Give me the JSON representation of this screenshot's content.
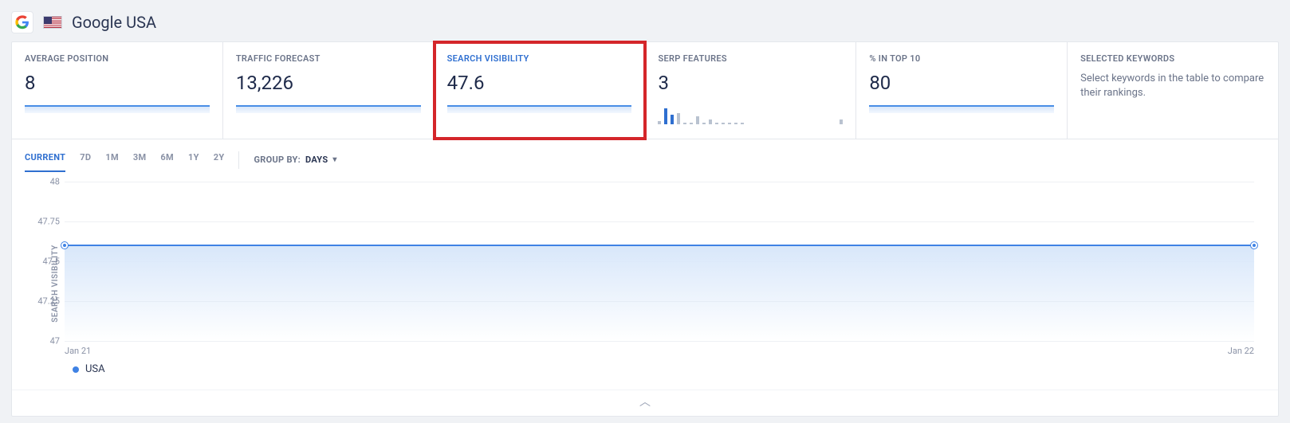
{
  "header": {
    "title": "Google USA",
    "engine_icon": "google-logo-icon",
    "flag_icon": "usa-flag-icon"
  },
  "cards": [
    {
      "key": "avg_position",
      "label": "AVERAGE POSITION",
      "value": "8",
      "spark": true
    },
    {
      "key": "traffic_forecast",
      "label": "TRAFFIC FORECAST",
      "value": "13,226",
      "spark": true
    },
    {
      "key": "search_visibility",
      "label": "SEARCH VISIBILITY",
      "value": "47.6",
      "spark": true,
      "active": true,
      "highlighted": true
    },
    {
      "key": "serp_features",
      "label": "SERP FEATURES",
      "value": "3",
      "bars": true
    },
    {
      "key": "pct_top10",
      "label": "% IN TOP 10",
      "value": "80",
      "spark": true
    }
  ],
  "selected_keywords_card": {
    "label": "SELECTED KEYWORDS",
    "hint": "Select keywords in the table to compare their rankings."
  },
  "range_tabs": [
    "CURRENT",
    "7D",
    "1M",
    "3M",
    "6M",
    "1Y",
    "2Y"
  ],
  "range_active": "CURRENT",
  "group_by": {
    "label": "GROUP BY:",
    "value": "DAYS"
  },
  "legend": {
    "series_0": "USA"
  },
  "chart_data": {
    "type": "line",
    "ylabel": "SEARCH VISIBILITY",
    "xlabel": "",
    "ylim": [
      47,
      48
    ],
    "yticks": [
      47,
      47.25,
      47.5,
      47.75,
      48
    ],
    "categories": [
      "Jan 21",
      "Jan 22"
    ],
    "series": [
      {
        "name": "USA",
        "color": "#3f82e4",
        "values": [
          47.6,
          47.6
        ]
      }
    ]
  }
}
